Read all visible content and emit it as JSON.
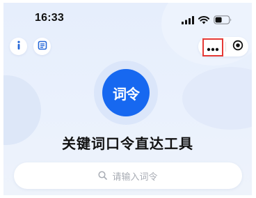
{
  "status_bar": {
    "time": "16:33",
    "icons": [
      "signal-icon",
      "wifi-icon",
      "battery-icon"
    ]
  },
  "toolbar_left": {
    "info_icon": "info-icon",
    "notes_icon": "notes-icon"
  },
  "capsule": {
    "more_icon": "more-dots-icon",
    "close_icon": "target-close-icon",
    "highlight_color": "#e53935"
  },
  "logo": {
    "text": "词令",
    "color": "#1768f0"
  },
  "title": "关键词口令直达工具",
  "search": {
    "placeholder": "请输入词令"
  }
}
